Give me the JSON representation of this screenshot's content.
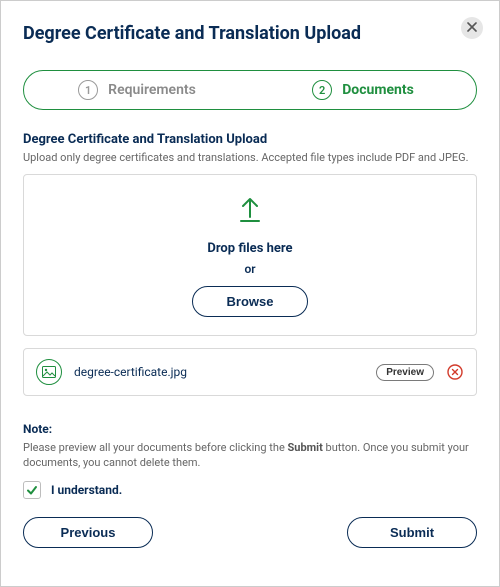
{
  "title": "Degree Certificate and Translation Upload",
  "steps": [
    {
      "num": "1",
      "label": "Requirements"
    },
    {
      "num": "2",
      "label": "Documents"
    }
  ],
  "upload": {
    "heading": "Degree Certificate and Translation Upload",
    "sub": "Upload only degree certificates and translations. Accepted file types include PDF and JPEG.",
    "drop_text": "Drop files here",
    "or_text": "or",
    "browse_label": "Browse"
  },
  "files": [
    {
      "name": "degree-certificate.jpg",
      "preview_label": "Preview"
    }
  ],
  "note": {
    "heading": "Note:",
    "text_before": "Please preview all your documents before clicking the ",
    "text_bold": "Submit",
    "text_after": " button. Once you submit your documents, you cannot delete them.",
    "checkbox_label": "I understand."
  },
  "buttons": {
    "previous": "Previous",
    "submit": "Submit"
  }
}
